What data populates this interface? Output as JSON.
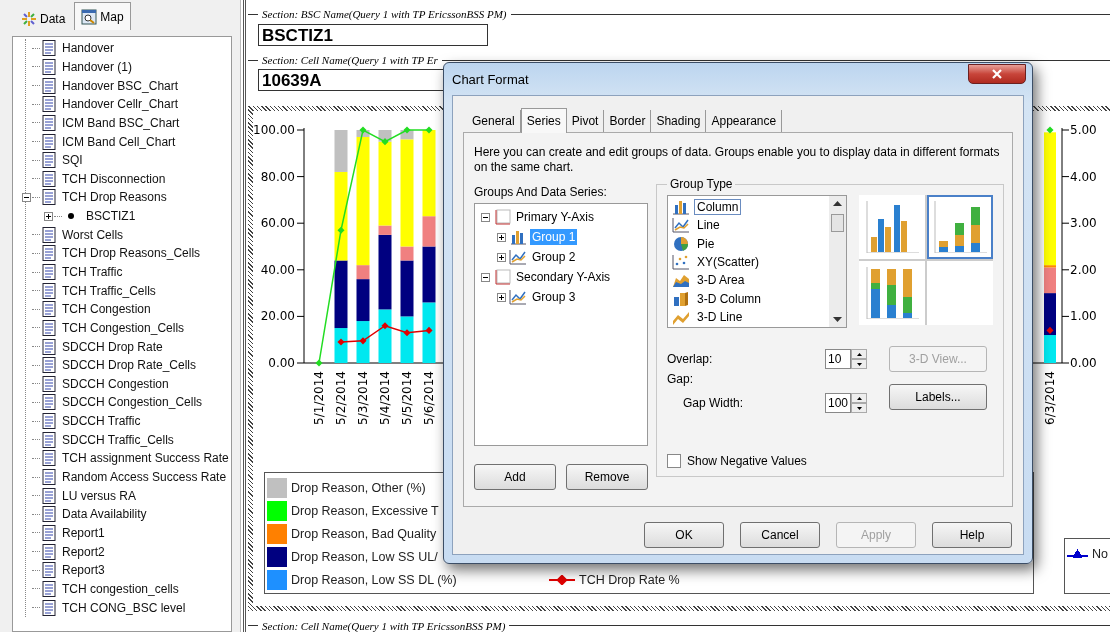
{
  "left_tabs": [
    {
      "label": "Data",
      "kind": "data",
      "selected": false
    },
    {
      "label": "Map",
      "kind": "map",
      "selected": true
    }
  ],
  "report_tree": [
    {
      "label": "Handover",
      "kind": "report"
    },
    {
      "label": "Handover (1)",
      "kind": "report"
    },
    {
      "label": "Handover BSC_Chart",
      "kind": "report"
    },
    {
      "label": "Handover Cellr_Chart",
      "kind": "report"
    },
    {
      "label": "ICM Band BSC_Chart",
      "kind": "report"
    },
    {
      "label": "ICM Band Cell_Chart",
      "kind": "report"
    },
    {
      "label": "SQI",
      "kind": "report"
    },
    {
      "label": "TCH Disconnection",
      "kind": "report"
    },
    {
      "label": "TCH Drop Reasons",
      "kind": "report",
      "expanded": true,
      "children": [
        {
          "label": "BSCTIZ1",
          "kind": "section",
          "expanded": false
        }
      ]
    },
    {
      "label": "Worst Cells",
      "kind": "report"
    },
    {
      "label": "TCH Drop Reasons_Cells",
      "kind": "report"
    },
    {
      "label": "TCH Traffic",
      "kind": "report"
    },
    {
      "label": "TCH Traffic_Cells",
      "kind": "report"
    },
    {
      "label": "TCH Congestion",
      "kind": "report"
    },
    {
      "label": "TCH Congestion_Cells",
      "kind": "report"
    },
    {
      "label": "SDCCH Drop Rate",
      "kind": "report"
    },
    {
      "label": "SDCCH Drop Rate_Cells",
      "kind": "report"
    },
    {
      "label": "SDCCH Congestion",
      "kind": "report"
    },
    {
      "label": "SDCCH Congestion_Cells",
      "kind": "report"
    },
    {
      "label": "SDCCH Traffic",
      "kind": "report"
    },
    {
      "label": "SDCCH Traffic_Cells",
      "kind": "report"
    },
    {
      "label": "TCH assignment Success Rate",
      "kind": "report"
    },
    {
      "label": "Random Access Success Rate",
      "kind": "report"
    },
    {
      "label": "LU versus RA",
      "kind": "report"
    },
    {
      "label": "Data Availability",
      "kind": "report"
    },
    {
      "label": "Report1",
      "kind": "report"
    },
    {
      "label": "Report2",
      "kind": "report"
    },
    {
      "label": "Report3",
      "kind": "report"
    },
    {
      "label": "TCH congestion_cells",
      "kind": "report"
    },
    {
      "label": "TCH CONG_BSC level",
      "kind": "report"
    }
  ],
  "report": {
    "sections": [
      {
        "heading": "Section: BSC Name(Query 1 with TP EricssonBSS PM)",
        "value": "BSCTIZ1"
      },
      {
        "heading": "Section: Cell Name(Query 1 with TP Er",
        "value": "10639A"
      }
    ],
    "next_section_heading": "Section: Cell Name(Query 1 with TP EricssonBSS PM)"
  },
  "chart": {
    "left": {
      "chart_data": {
        "type": "bar",
        "stacked": true,
        "categories": [
          "5/1/2014",
          "5/2/2014",
          "5/3/2014",
          "5/4/2014",
          "5/5/2014",
          "5/6/2014"
        ],
        "ylim": [
          0,
          100
        ],
        "yticks": [
          {
            "value": 0,
            "label": "0.00"
          },
          {
            "value": 20,
            "label": "20.00"
          },
          {
            "value": 40,
            "label": "40.00"
          },
          {
            "value": 60,
            "label": "60.00"
          },
          {
            "value": 80,
            "label": "80.00"
          },
          {
            "value": 100,
            "label": "100.00"
          }
        ],
        "series": [
          {
            "type": "bar",
            "color": "#00e8f0",
            "values": [
              null,
              15,
              18,
              23,
              20,
              26
            ]
          },
          {
            "type": "bar",
            "color": "#000080",
            "values": [
              null,
              29,
              18,
              32,
              24,
              24
            ]
          },
          {
            "type": "bar",
            "color": "#f08080",
            "values": [
              null,
              0,
              6,
              4,
              6,
              13
            ]
          },
          {
            "type": "bar",
            "color": "#ffff00",
            "values": [
              null,
              38,
              55,
              36,
              46,
              37
            ]
          },
          {
            "type": "bar",
            "color": "#c0c0c0",
            "values": [
              null,
              18,
              3,
              5,
              4,
              0
            ]
          },
          {
            "type": "line",
            "marker": "diamond",
            "color": "#22dd22",
            "values": [
              0,
              57,
              100,
              95,
              100,
              100
            ]
          },
          {
            "type": "line",
            "marker": "diamond",
            "color": "#e00000",
            "values": [
              null,
              9,
              9.5,
              16,
              13,
              14
            ]
          }
        ]
      }
    },
    "right": {
      "chart_data": {
        "type": "bar",
        "stacked": true,
        "categories": [
          "6/3/2014"
        ],
        "ylim": [
          0,
          5
        ],
        "yticks": [
          {
            "value": 0,
            "label": "0.00"
          },
          {
            "value": 1,
            "label": "1.00"
          },
          {
            "value": 2,
            "label": "2.00"
          },
          {
            "value": 3,
            "label": "3.00"
          },
          {
            "value": 4,
            "label": "4.00"
          },
          {
            "value": 5,
            "label": "5.00"
          }
        ],
        "series": [
          {
            "type": "bar",
            "color": "#00e8f0",
            "values": [
              0.6
            ]
          },
          {
            "type": "bar",
            "color": "#000080",
            "values": [
              0.9
            ]
          },
          {
            "type": "bar",
            "color": "#f08080",
            "values": [
              0.55
            ]
          },
          {
            "type": "bar",
            "color": "#ff8c00",
            "values": [
              0.05
            ]
          },
          {
            "type": "bar",
            "color": "#ffff00",
            "values": [
              2.85
            ]
          },
          {
            "type": "line",
            "marker": "diamond",
            "color": "#22dd22",
            "values": [
              5
            ]
          },
          {
            "type": "line",
            "marker": "diamond",
            "color": "#e00000",
            "values": [
              0.7
            ]
          }
        ]
      }
    },
    "legend": {
      "column_1": [
        {
          "label": "Drop Reason, Other (%)",
          "kind": "swatch",
          "color": "#c0c0c0"
        },
        {
          "label": "Drop Reason, Excessive T",
          "kind": "swatch",
          "color": "#00ff00"
        },
        {
          "label": "Drop Reason, Bad Quality",
          "kind": "swatch",
          "color": "#ff8000"
        },
        {
          "label": "Drop Reason, Low SS UL/",
          "kind": "swatch",
          "color": "#000080"
        },
        {
          "label": "Drop Reason, Low SS DL (%)",
          "kind": "swatch",
          "color": "#1e90ff"
        }
      ],
      "column_2": [
        {
          "label": "TCH Drop Rate %",
          "kind": "diamond-line",
          "color": "#e00000"
        }
      ]
    },
    "right_legend": [
      {
        "label": "No",
        "kind": "triangle-line",
        "color": "#0000cc"
      }
    ]
  },
  "dialog": {
    "title": "Chart Format",
    "tabs": [
      {
        "label": "General",
        "selected": false
      },
      {
        "label": "Series",
        "selected": true
      },
      {
        "label": "Pivot",
        "selected": false
      },
      {
        "label": "Border",
        "selected": false
      },
      {
        "label": "Shading",
        "selected": false
      },
      {
        "label": "Appearance",
        "selected": false
      }
    ],
    "description": "Here you can create and edit groups of data. Groups enable you to display data in different formats on the same chart.",
    "series_label": "Groups And Data Series:",
    "series_tree": [
      {
        "label": "Primary Y-Axis",
        "kind": "axis",
        "expanded": true,
        "selected": false,
        "children": [
          {
            "label": "Group 1",
            "kind": "column",
            "expanded": false,
            "selected": true
          },
          {
            "label": "Group 2",
            "kind": "line",
            "expanded": false,
            "selected": false
          }
        ]
      },
      {
        "label": "Secondary Y-Axis",
        "kind": "axis",
        "expanded": true,
        "selected": false,
        "children": [
          {
            "label": "Group 3",
            "kind": "line",
            "expanded": false,
            "selected": false
          }
        ]
      }
    ],
    "series_buttons": [
      "Add",
      "Remove"
    ],
    "group_type": {
      "legend": "Group Type",
      "types": [
        {
          "label": "Column",
          "kind": "column",
          "selected": true
        },
        {
          "label": "Line",
          "kind": "line",
          "selected": false
        },
        {
          "label": "Pie",
          "kind": "pie",
          "selected": false
        },
        {
          "label": "XY(Scatter)",
          "kind": "scatter",
          "selected": false
        },
        {
          "label": "3-D Area",
          "kind": "area3d",
          "selected": false
        },
        {
          "label": "3-D Column",
          "kind": "column3d",
          "selected": false
        },
        {
          "label": "3-D Line",
          "kind": "line3d",
          "selected": false
        }
      ],
      "subtypes": [
        {
          "kind": "clustered",
          "selected": false
        },
        {
          "kind": "stacked",
          "selected": true
        },
        {
          "kind": "percent",
          "selected": false
        },
        {
          "kind": "empty",
          "selected": false
        }
      ],
      "overlap": {
        "label": "Overlap:",
        "value": "10"
      },
      "gap_label": "Gap:",
      "gap_width": {
        "label": "Gap Width:",
        "value": "100"
      },
      "view_button": {
        "label": "3-D View...",
        "disabled": true
      },
      "labels_button": {
        "label": "Labels...",
        "disabled": false
      },
      "negative": {
        "label": "Show Negative Values",
        "checked": false
      }
    },
    "footer_buttons": [
      {
        "label": "OK",
        "disabled": false
      },
      {
        "label": "Cancel",
        "disabled": false
      },
      {
        "label": "Apply",
        "disabled": true
      },
      {
        "label": "Help",
        "disabled": false
      }
    ]
  }
}
